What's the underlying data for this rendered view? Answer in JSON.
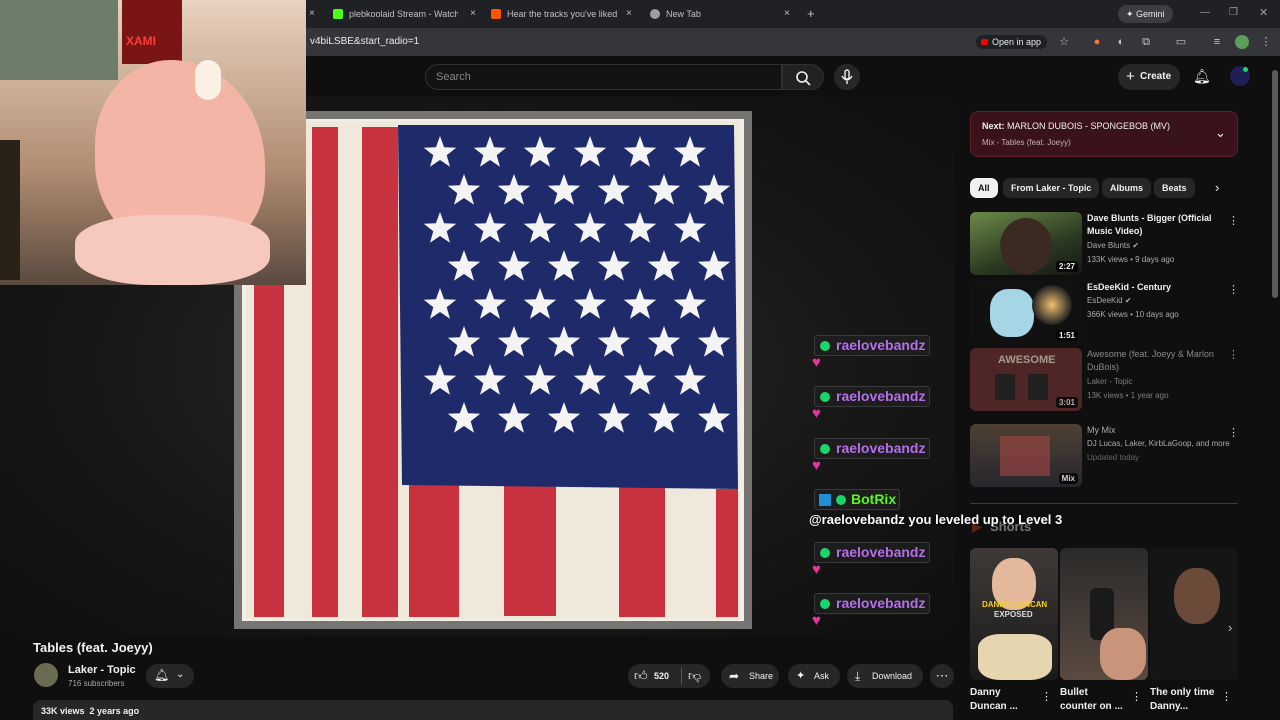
{
  "browser": {
    "tabs": [
      {
        "title": "plebkoolaid Stream - Watch Li...",
        "favicon_color": "#53fc18"
      },
      {
        "title": "Hear the tracks you've liked: on...",
        "favicon_color": "#ff5500"
      },
      {
        "title": "New Tab",
        "favicon_color": "#9aa0a6"
      }
    ],
    "new_tab_symbol": "+",
    "close_symbol": "×",
    "url": "v4biLSBE&start_radio=1",
    "open_in_app": "Open in app",
    "gemini": "Gemini"
  },
  "header": {
    "search_placeholder": "Search",
    "create_label": "Create"
  },
  "video": {
    "title": "Tables (feat. Joeyy)",
    "channel": "Laker - Topic",
    "subscribers": "716 subscribers",
    "likes": "520",
    "share": "Share",
    "ask": "Ask",
    "download": "Download",
    "views": "33K views",
    "age": "2 years ago"
  },
  "webcam_overlay": {
    "poster_text": "XAMI"
  },
  "next_card": {
    "label": "Next:",
    "title": "MARLON DUBOIS - SPONGEBOB (MV)",
    "subtitle": "Mix - Tables (feat. Joeyy)"
  },
  "chips": [
    "All",
    "From Laker - Topic",
    "Albums",
    "Beats"
  ],
  "recommendations": [
    {
      "title": "Dave Blunts - Bigger (Official Music Video)",
      "channel": "Dave Blunts",
      "meta": "133K views • 9 days ago",
      "duration": "2:27"
    },
    {
      "title": "EsDeeKid - Century",
      "channel": "EsDeeKid",
      "meta": "366K views • 10 days ago",
      "duration": "1:51"
    },
    {
      "title": "Awesome (feat. Joeyy & Marlon DuBois)",
      "channel": "Laker - Topic",
      "meta": "13K views • 1 year ago",
      "duration": "3:01",
      "thumb_text": "AWESOME"
    },
    {
      "title": "My Mix",
      "channel": "DJ Lucas, Laker, KirbLaGoop, and more",
      "meta": "Updated today",
      "duration": "Mix"
    }
  ],
  "shorts_heading": "Shorts",
  "shorts": [
    {
      "title": "Danny Duncan ...",
      "thumb_text": "DANNY DUNCAN",
      "thumb_sub": "EXPOSED"
    },
    {
      "title": "Bullet counter on ..."
    },
    {
      "title": "The only time Danny..."
    }
  ],
  "chat": {
    "messages": [
      {
        "user": "raelovebandz"
      },
      {
        "user": "raelovebandz"
      },
      {
        "user": "raelovebandz"
      },
      {
        "user": "raelovebandz"
      },
      {
        "user": "raelovebandz"
      }
    ],
    "heart": "♥",
    "bot": {
      "user": "BotRix",
      "text": "@raelovebandz you leveled up to Level 3"
    }
  },
  "colors": {
    "chat_name": "#b570e8",
    "bot_name": "#53fc18",
    "verified": "#19d66b"
  }
}
